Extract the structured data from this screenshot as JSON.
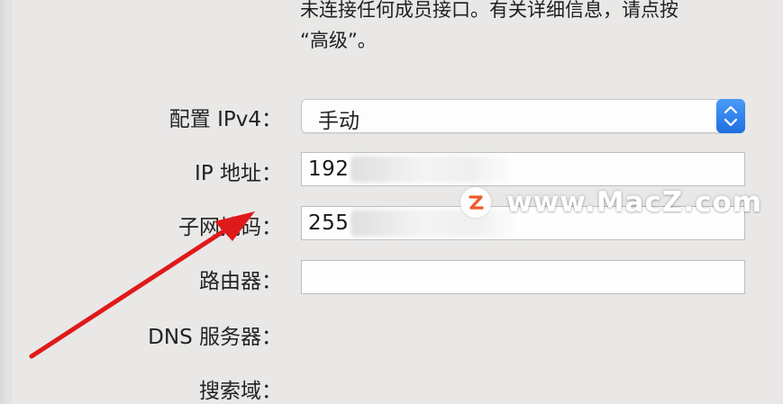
{
  "info": {
    "line1": "未连接任何成员接口。有关详细信息，请点按",
    "line2": "“高级”。"
  },
  "form": {
    "configure_label": "配置 IPv4：",
    "configure_value": "手动",
    "ip_label": "IP 地址：",
    "ip_value": "192",
    "subnet_label": "子网掩码：",
    "subnet_value": "255",
    "router_label": "路由器：",
    "router_value": "",
    "dns_label": "DNS 服务器：",
    "search_label": "搜索域："
  },
  "watermark": {
    "text": "www.MacZ.com",
    "logo_letter": "z"
  },
  "colors": {
    "background": "#e9e8e7",
    "accent": "#1f6fe0",
    "annotation_arrow": "#e0191a",
    "watermark_logo": "#f05a28"
  },
  "icons": {
    "stepper": "chevron-up-down-icon",
    "annotation": "red-arrow-icon"
  }
}
